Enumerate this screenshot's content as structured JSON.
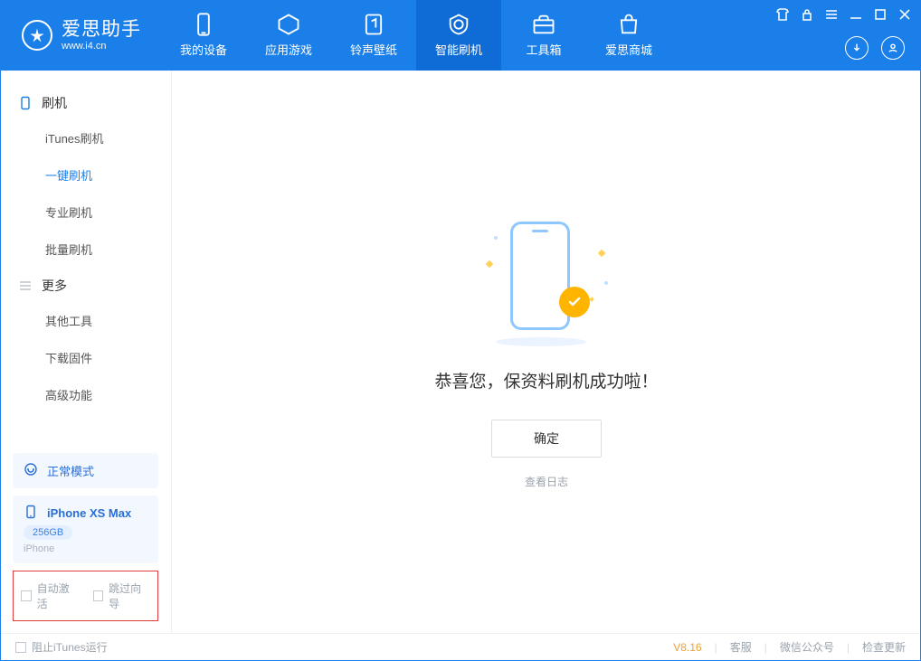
{
  "brand": {
    "title": "爱思助手",
    "url": "www.i4.cn"
  },
  "tabs": [
    {
      "label": "我的设备",
      "icon": "device-icon"
    },
    {
      "label": "应用游戏",
      "icon": "apps-icon"
    },
    {
      "label": "铃声壁纸",
      "icon": "ringtone-icon"
    },
    {
      "label": "智能刷机",
      "icon": "flash-icon"
    },
    {
      "label": "工具箱",
      "icon": "toolbox-icon"
    },
    {
      "label": "爱思商城",
      "icon": "store-icon"
    }
  ],
  "active_tab_index": 3,
  "sidebar": {
    "group1": {
      "title": "刷机",
      "items": [
        "iTunes刷机",
        "一键刷机",
        "专业刷机",
        "批量刷机"
      ]
    },
    "group2": {
      "title": "更多",
      "items": [
        "其他工具",
        "下载固件",
        "高级功能"
      ]
    },
    "active_item": "一键刷机",
    "mode": "正常模式",
    "device": {
      "name": "iPhone XS Max",
      "capacity": "256GB",
      "type": "iPhone"
    },
    "checks": {
      "auto_activate": "自动激活",
      "skip_guide": "跳过向导"
    }
  },
  "main": {
    "success_title": "恭喜您，保资料刷机成功啦！",
    "ok_label": "确定",
    "log_link": "查看日志"
  },
  "statusbar": {
    "block_itunes": "阻止iTunes运行",
    "version": "V8.16",
    "links": [
      "客服",
      "微信公众号",
      "检查更新"
    ]
  }
}
